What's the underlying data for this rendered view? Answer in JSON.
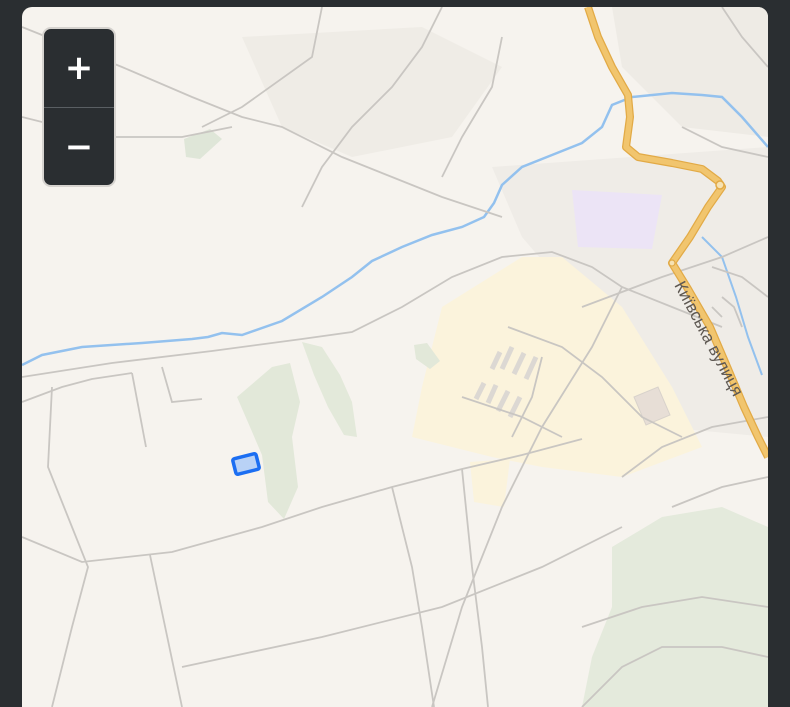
{
  "map": {
    "street_label": "Київська вулиця",
    "colors": {
      "background": "#f6f3ee",
      "road_major": "#f1c56e",
      "road_major_casing": "#e2aa46",
      "road_minor": "#c9c6c2",
      "river": "#93c1ee",
      "vegetation": "#e2e8d9",
      "residential": "#fbf3dc",
      "institution": "#ece4f6",
      "parcel_marker": "#1b6ef2"
    }
  },
  "zoom": {
    "in_label": "+",
    "out_label": "−"
  }
}
